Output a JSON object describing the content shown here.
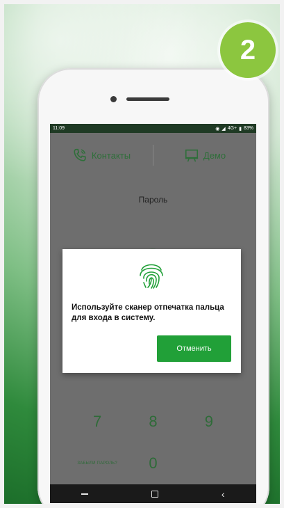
{
  "step_badge": "2",
  "status_bar": {
    "time": "11:09",
    "network": "4G+",
    "battery": "83%"
  },
  "top_nav": {
    "contacts_label": "Контакты",
    "demo_label": "Демо"
  },
  "password_label": "Пароль",
  "keypad": {
    "row1": [
      "7",
      "8",
      "9"
    ],
    "forgot_label": "ЗАБЫЛИ ПАРОЛЬ?",
    "zero": "0"
  },
  "dialog": {
    "message": "Используйте сканер отпечатка пальца для входа в систему.",
    "cancel_label": "Отменить"
  },
  "colors": {
    "brand_green": "#21a038",
    "badge_green": "#8cc63f"
  }
}
